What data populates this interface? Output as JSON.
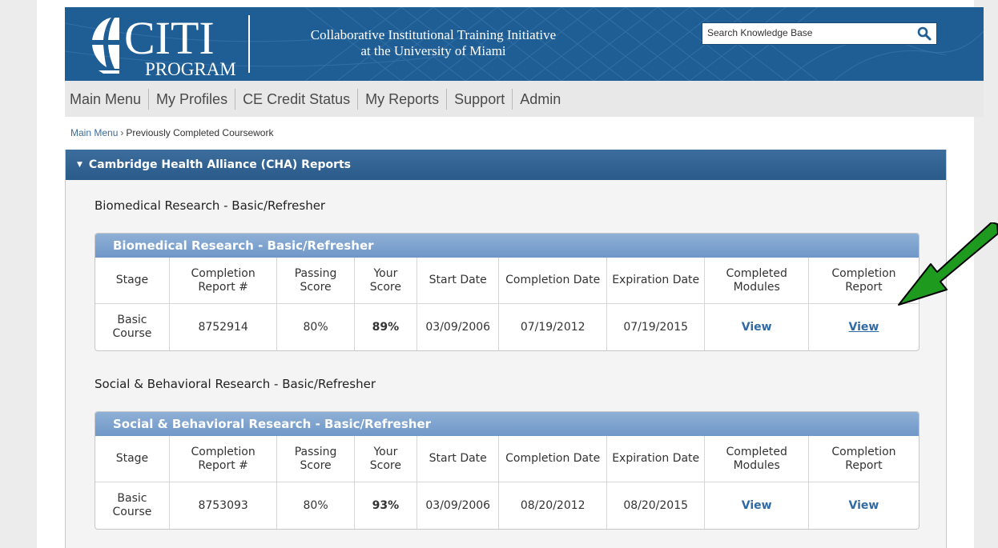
{
  "header": {
    "logo_main": "CITI",
    "logo_sub": "PROGRAM",
    "institution_line1": "Collaborative Institutional Training Initiative",
    "institution_line2": "at the University of Miami",
    "search_placeholder": "Search Knowledge Base",
    "search_icon": "search-icon"
  },
  "nav": [
    "Main Menu",
    "My Profiles",
    "CE Credit Status",
    "My Reports",
    "Support",
    "Admin"
  ],
  "breadcrumb": {
    "link": "Main Menu",
    "separator": "›",
    "current": "Previously Completed Coursework"
  },
  "panel": {
    "title": "Cambridge Health Alliance (CHA) Reports",
    "sections": [
      {
        "title": "Biomedical Research - Basic/Refresher",
        "table_caption": "Biomedical Research - Basic/Refresher",
        "columns": [
          "Stage",
          "Completion Report #",
          "Passing Score",
          "Your Score",
          "Start Date",
          "Completion Date",
          "Expiration Date",
          "Completed Modules",
          "Completion Report"
        ],
        "row": [
          "Basic Course",
          "8752914",
          "80%",
          "89%",
          "03/09/2006",
          "07/19/2012",
          "07/19/2015",
          "View",
          "View"
        ]
      },
      {
        "title": "Social & Behavioral Research - Basic/Refresher",
        "table_caption": "Social & Behavioral Research - Basic/Refresher",
        "columns": [
          "Stage",
          "Completion Report #",
          "Passing Score",
          "Your Score",
          "Start Date",
          "Completion Date",
          "Expiration Date",
          "Completed Modules",
          "Completion Report"
        ],
        "row": [
          "Basic Course",
          "8753093",
          "80%",
          "93%",
          "03/09/2006",
          "08/20/2012",
          "08/20/2015",
          "View",
          "View"
        ]
      }
    ]
  },
  "colors": {
    "header_blue": "#1f5e95",
    "panel_head": "#2a5a89",
    "caption_blue": "#6f97c8",
    "link": "#2f6aa5",
    "arrow_green": "#1e9a1e"
  }
}
